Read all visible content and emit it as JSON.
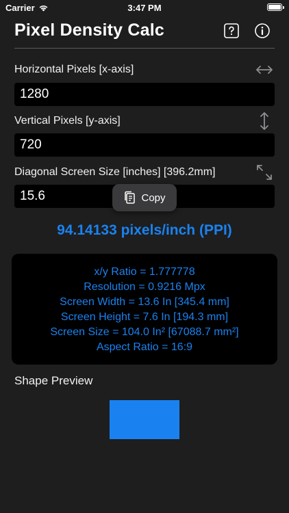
{
  "status_bar": {
    "carrier": "Carrier",
    "time": "3:47 PM"
  },
  "header": {
    "title": "Pixel Density Calc",
    "help_icon": "question-square-icon",
    "info_icon": "info-circle-icon"
  },
  "inputs": {
    "horizontal": {
      "label": "Horizontal Pixels  [x-axis]",
      "value": "1280",
      "icon": "horizontal-arrows-icon"
    },
    "vertical": {
      "label": "Vertical Pixels [y-axis]",
      "value": "720",
      "icon": "vertical-arrows-icon"
    },
    "diagonal": {
      "label": "Diagonal Screen Size [inches] [396.2mm]",
      "value": "15.6",
      "icon": "diagonal-arrows-icon"
    }
  },
  "copy_menu": {
    "label": "Copy",
    "icon": "clipboard-icon"
  },
  "ppi": "94.14133 pixels/inch (PPI)",
  "results": [
    "x/y Ratio = 1.777778",
    "Resolution = 0.9216 Mpx",
    "Screen Width = 13.6 In [345.4 mm]",
    "Screen Height = 7.6 In [194.3 mm]",
    "Screen Size = 104.0 In² [67088.7 mm²]",
    "Aspect Ratio = 16:9"
  ],
  "preview": {
    "label": "Shape Preview"
  },
  "colors": {
    "background": "#1e1e1e",
    "accent": "#1a82f0",
    "field": "#000000",
    "popover": "#3a3a3c"
  }
}
